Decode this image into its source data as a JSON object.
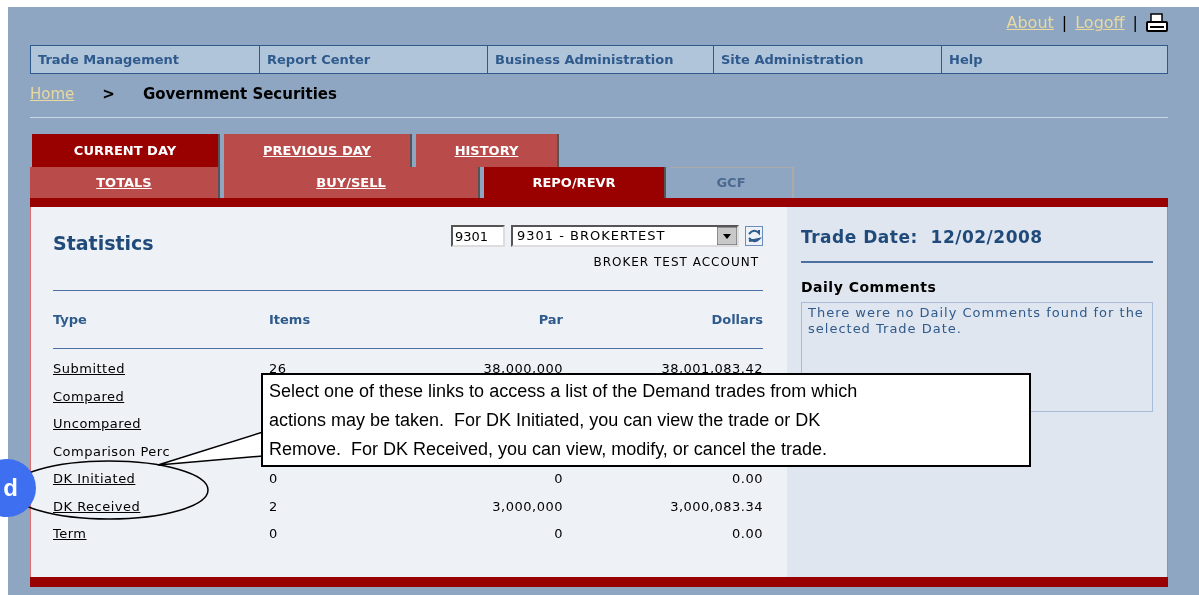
{
  "header_links": [
    "About",
    "Logoff"
  ],
  "header_separators": [
    "|",
    "|"
  ],
  "nav": [
    "Trade Management",
    "Report Center",
    "Business Administration",
    "Site Administration",
    "Help"
  ],
  "breadcrumb": {
    "home": "Home",
    "separator": ">",
    "current": "Government Securities"
  },
  "tabs_top": [
    {
      "label": "CURRENT DAY",
      "selected": true
    },
    {
      "label": "PREVIOUS DAY",
      "selected": false
    },
    {
      "label": "HISTORY",
      "selected": false
    }
  ],
  "tabs_bottom": [
    {
      "label": "TOTALS",
      "selected": false,
      "disabled": false
    },
    {
      "label": "BUY/SELL",
      "selected": false,
      "disabled": false
    },
    {
      "label": "REPO/REVR",
      "selected": true,
      "disabled": false
    },
    {
      "label": "GCF",
      "selected": false,
      "disabled": true
    }
  ],
  "statistics": {
    "title": "Statistics",
    "account_code": "9301",
    "account_select": "9301 - BROKERTEST",
    "account_name": "BROKER TEST ACCOUNT",
    "columns": [
      "Type",
      "Items",
      "Par",
      "Dollars"
    ],
    "rows": [
      {
        "type": "Submitted",
        "link": true,
        "items": "26",
        "par": "38,000,000",
        "dollars": "38,001,083.42"
      },
      {
        "type": "Compared",
        "link": true
      },
      {
        "type": "Uncompared",
        "link": true
      },
      {
        "type": "Comparison Perc",
        "link": false
      },
      {
        "type": "DK Initiated",
        "link": true,
        "items": "0",
        "par": "0",
        "dollars": "0.00"
      },
      {
        "type": "DK Received",
        "link": true,
        "items": "2",
        "par": "3,000,000",
        "dollars": "3,000,083.34"
      },
      {
        "type": "Term",
        "link": true,
        "items": "0",
        "par": "0",
        "dollars": "0.00"
      }
    ]
  },
  "trade_date": "Trade Date:  12/02/2008",
  "daily_comments": {
    "title": "Daily Comments",
    "text": "There were no Daily Comments found for the selected Trade Date."
  },
  "callout": {
    "lines": [
      "Select one of these links to access a list of the Demand trades from which",
      "actions may be taken.  For DK Initiated, you can view the trade or DK",
      "Remove.  For DK Received, you can view, modify, or cancel the trade."
    ],
    "badge": "d"
  }
}
